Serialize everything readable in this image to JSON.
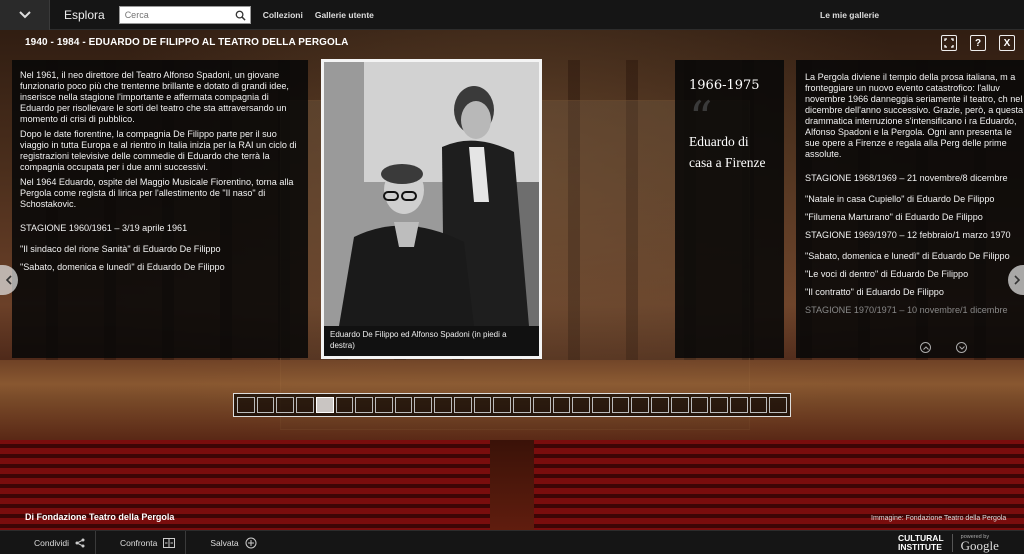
{
  "topbar": {
    "explore": "Esplora",
    "search_placeholder": "Cerca",
    "collections": "Collezioni",
    "user_galleries": "Gallerie utente",
    "my_galleries": "Le mie gallerie"
  },
  "exhibit": {
    "title": "1940 - 1984 - EDUARDO DE FILIPPO AL TEATRO DELLA PERGOLA",
    "help_label": "?",
    "close_label": "X"
  },
  "panel1": {
    "paragraphs": [
      "Nel 1961, il neo direttore del Teatro Alfonso Spadoni, un giovane funzionario poco più che trentenne brillante e dotato di grandi idee, inserisce nella stagione l'importante e affermata compagnia di Eduardo per risollevare le sorti del teatro che sta attraversando un momento di crisi di pubblico.",
      "Dopo le date fiorentine, la compagnia De Filippo parte per il suo viaggio in tutta Europa e al rientro in Italia inizia per la RAI un ciclo di registrazioni televisive delle commedie di Eduardo che terrà la compagnia occupata per i due anni successivi.",
      "Nel 1964 Eduardo, ospite del Maggio Musicale Fiorentino, torna alla Pergola come regista di lirica per l'allestimento de \"Il naso\" di Schostakovic."
    ],
    "season": "STAGIONE 1960/1961 – 3/19 aprile 1961",
    "plays": [
      "\"Il sindaco del rione Sanità\" di Eduardo De Filippo",
      "\"Sabato, domenica e lunedì\" di Eduardo De Filippo"
    ]
  },
  "photo": {
    "caption": "Eduardo De Filippo ed Alfonso Spadoni (in piedi a destra)"
  },
  "panel3": {
    "years": "1966-1975",
    "quote": "Eduardo di casa a Firenze"
  },
  "panel4": {
    "paragraph": "La Pergola diviene il tempio della prosa italiana, m a fronteggiare un nuovo evento catastrofico: l'alluv novembre 1966 danneggia seriamente il teatro, ch nel dicembre dell'anno successivo. Grazie, però, a questa drammatica interruzione s'intensificano i ra Eduardo,  Alfonso Spadoni e la Pergola. Ogni ann presenta le sue opere a Firenze e regala alla Perg delle prime assolute.",
    "season1": "STAGIONE 1968/1969 – 21 novembre/8 dicembre",
    "season1_plays": [
      "\"Natale in casa Cupiello\" di Eduardo De Filippo",
      "\"Filumena Marturano\" di Eduardo De Filippo"
    ],
    "season2": "STAGIONE 1969/1970 – 12 febbraio/1 marzo 1970",
    "season2_plays": [
      "\"Sabato, domenica e lunedì\" di Eduardo De Filippo",
      "\"Le voci di dentro\" di Eduardo De Filippo",
      "\"Il contratto\" di Eduardo De Filippo"
    ],
    "season3": "STAGIONE 1970/1971 – 10 novembre/1 dicembre"
  },
  "credits": {
    "left": "Di Fondazione Teatro della Pergola",
    "right": "Immagine: Fondazione Teatro della Pergola"
  },
  "bottombar": {
    "share": "Condividi",
    "compare": "Confronta",
    "saved": "Salvata",
    "brand_line1": "CULTURAL",
    "brand_line2": "INSTITUTE",
    "powered_by": "powered by",
    "google": "Google"
  }
}
